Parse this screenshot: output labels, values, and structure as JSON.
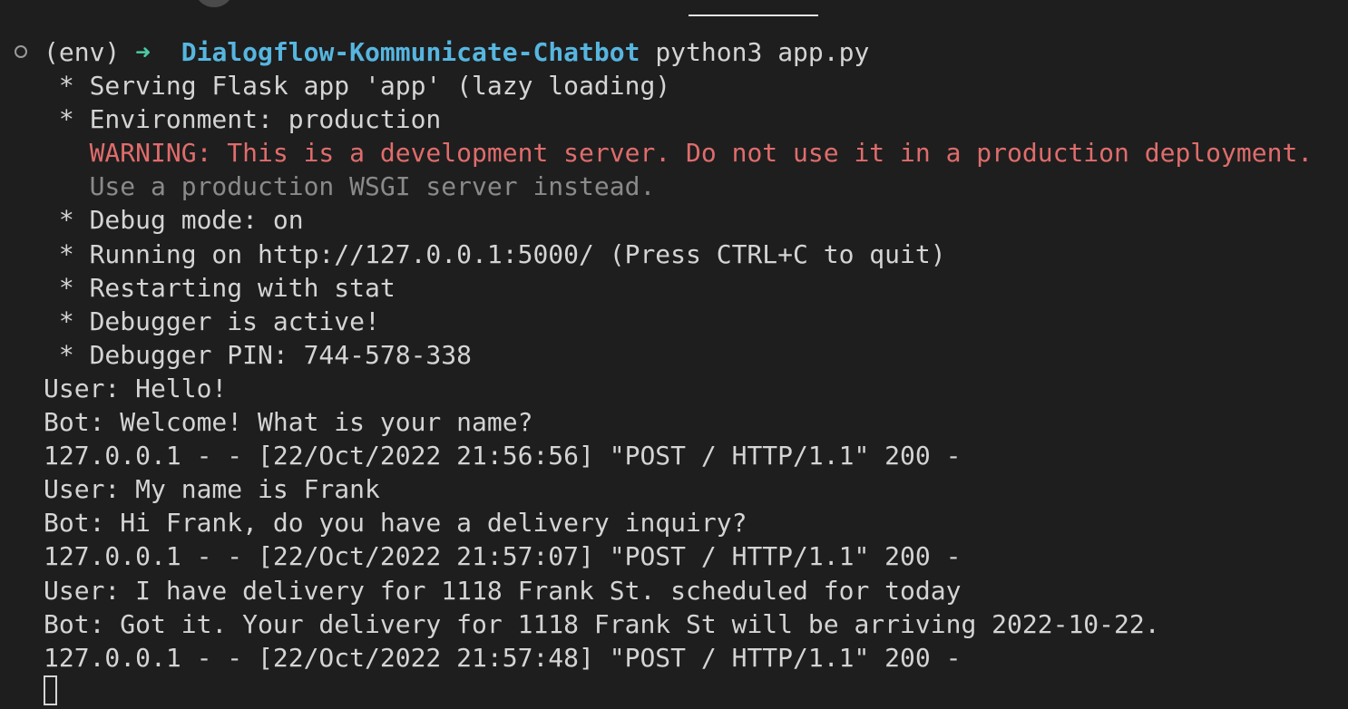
{
  "prompt": {
    "env": "(env)",
    "arrow": "➜",
    "directory": "Dialogflow-Kommunicate-Chatbot",
    "command": "python3 app.py"
  },
  "output": {
    "serving": " * Serving Flask app 'app' (lazy loading)",
    "environment": " * Environment: production",
    "warning": "   WARNING: This is a development server. Do not use it in a production deployment.",
    "wsgi_hint": "   Use a production WSGI server instead.",
    "debug_mode": " * Debug mode: on",
    "running": " * Running on http://127.0.0.1:5000/ (Press CTRL+C to quit)",
    "restarting": " * Restarting with stat",
    "debugger_active": " * Debugger is active!",
    "debugger_pin": " * Debugger PIN: 744-578-338"
  },
  "conversation": [
    {
      "text": "User: Hello!"
    },
    {
      "text": "Bot: Welcome! What is your name?"
    },
    {
      "text": "127.0.0.1 - - [22/Oct/2022 21:56:56] \"POST / HTTP/1.1\" 200 -"
    },
    {
      "text": "User: My name is Frank"
    },
    {
      "text": "Bot: Hi Frank, do you have a delivery inquiry?"
    },
    {
      "text": "127.0.0.1 - - [22/Oct/2022 21:57:07] \"POST / HTTP/1.1\" 200 -"
    },
    {
      "text": "User: I have delivery for 1118 Frank St. scheduled for today"
    },
    {
      "text": "Bot: Got it. Your delivery for 1118 Frank St will be arriving 2022-10-22."
    },
    {
      "text": "127.0.0.1 - - [22/Oct/2022 21:57:48] \"POST / HTTP/1.1\" 200 -"
    }
  ],
  "colors": {
    "background": "#1e1e1e",
    "text": "#d4d4d4",
    "arrow": "#4ec9a4",
    "directory": "#56b6e0",
    "warning": "#e06c6c",
    "dim": "#8a8a8a"
  }
}
